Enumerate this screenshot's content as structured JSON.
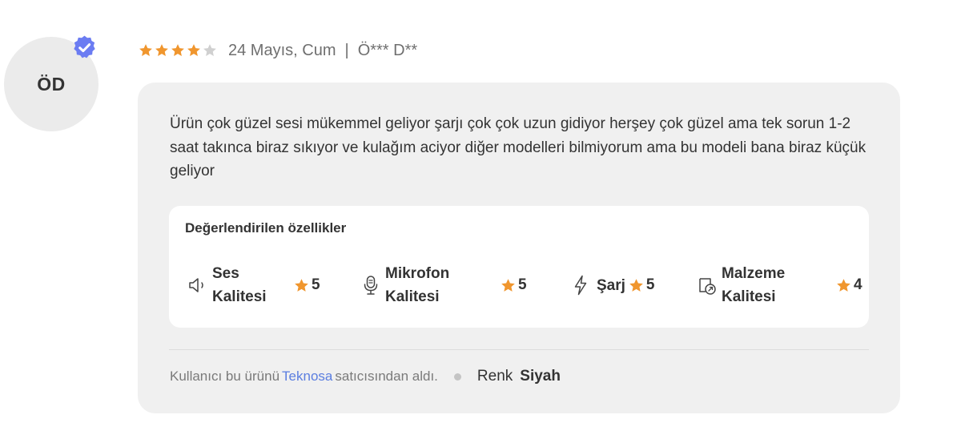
{
  "avatar": {
    "initials": "ÖD"
  },
  "review": {
    "rating": 4,
    "max_rating": 5,
    "date": "24 Mayıs, Cum",
    "separator": "|",
    "user": "Ö*** D**",
    "text": "Ürün çok güzel sesi mükemmel geliyor şarjı çok çok uzun gidiyor herşey çok güzel ama tek sorun 1-2 saat takınca biraz sıkıyor ve kulağım aciyor diğer modelleri bilmiyorum ama bu modeli bana biraz küçük geliyor"
  },
  "features": {
    "title": "Değerlendirilen özellikler",
    "items": [
      {
        "icon": "speaker-icon",
        "label_line1": "Ses",
        "label_line2": "Kalitesi",
        "score": "5"
      },
      {
        "icon": "microphone-icon",
        "label_line1": "Mikrofon",
        "label_line2": "Kalitesi",
        "score": "5"
      },
      {
        "icon": "lightning-icon",
        "label_line1": "Şarj",
        "label_line2": "",
        "score": "5"
      },
      {
        "icon": "material-icon",
        "label_line1": "Malzeme",
        "label_line2": "Kalitesi",
        "score": "4"
      }
    ]
  },
  "footer": {
    "purchase_prefix": "Kullanıcı bu ürünü",
    "seller": "Teknosa",
    "purchase_suffix": "satıcısından aldı.",
    "color_label": "Renk",
    "color_value": "Siyah"
  },
  "colors": {
    "star_filled": "#f0962e",
    "star_empty": "#d0d0d0",
    "verified_badge": "#6b7cf2",
    "seller_link": "#5b7ee0",
    "card_background": "#f0f0f0"
  }
}
